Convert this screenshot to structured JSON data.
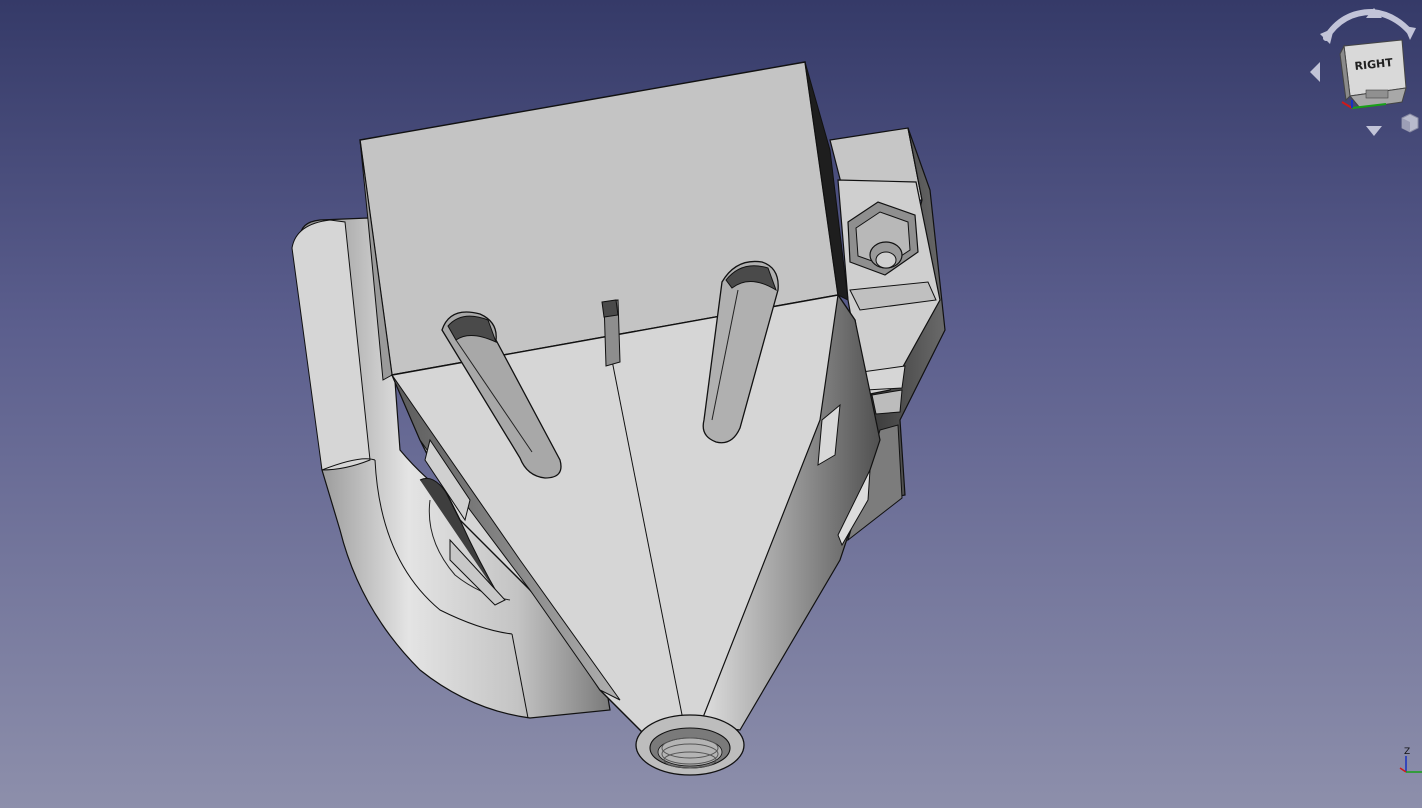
{
  "app": {
    "view_background_top": "#353a68",
    "view_background_bottom": "#8d8fab"
  },
  "navigation_cube": {
    "face_label": "RIGHT",
    "face_color": "#d8d8d8",
    "arrow_color": "#b9bcd0"
  },
  "axis_cross": {
    "z_label": "Z",
    "x_color": "#d01818",
    "y_color": "#18a018",
    "z_color": "#1830c0"
  },
  "model": {
    "body_color": "#c8c8c8",
    "edge_color": "#111111"
  }
}
